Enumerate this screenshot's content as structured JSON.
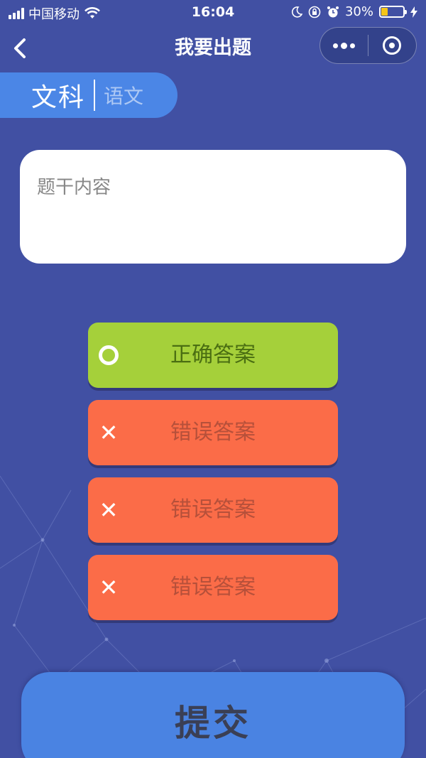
{
  "status_bar": {
    "carrier": "中国移动",
    "time": "16:04",
    "battery_percent": "30%",
    "battery_level": 0.3,
    "icons": [
      "signal-icon",
      "wifi-icon",
      "moon-icon",
      "lock-rotation-icon",
      "alarm-icon",
      "battery-icon",
      "charging-icon"
    ]
  },
  "nav": {
    "back_icon": "chevron-left-icon",
    "title": "我要出题",
    "capsule_icons": [
      "more-icon",
      "close-target-icon"
    ]
  },
  "category": {
    "main": "文科",
    "sub": "语文"
  },
  "question": {
    "placeholder": "题干内容"
  },
  "answers": {
    "correct": {
      "label": "正确答案",
      "icon": "circle-icon",
      "color": "#a5d03a"
    },
    "wrong": [
      {
        "label": "错误答案",
        "icon": "x-icon",
        "color": "#fb6c48"
      },
      {
        "label": "错误答案",
        "icon": "x-icon",
        "color": "#fb6c48"
      },
      {
        "label": "错误答案",
        "icon": "x-icon",
        "color": "#fb6c48"
      }
    ]
  },
  "submit": {
    "label": "提交"
  },
  "colors": {
    "background": "#4150a3",
    "accent": "#4b86e6"
  }
}
